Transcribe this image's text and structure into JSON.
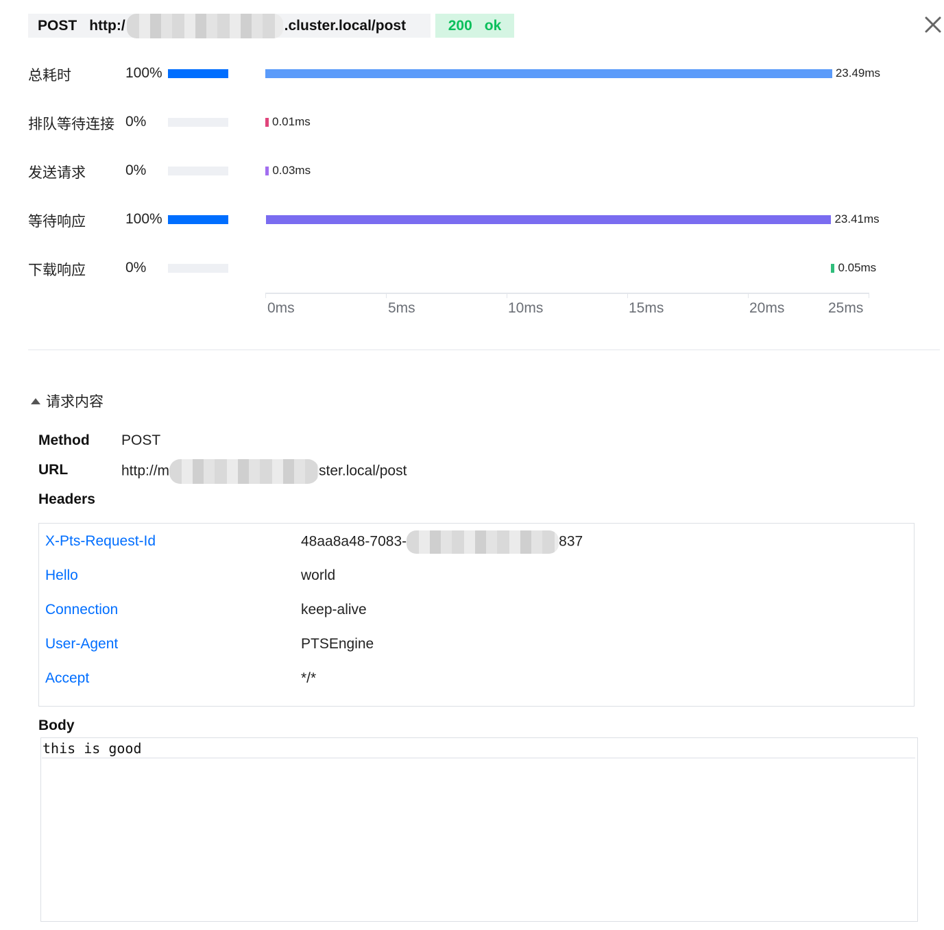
{
  "request": {
    "method": "POST",
    "url_prefix": "http:/",
    "url_suffix": ".cluster.local/post",
    "status_code": "200",
    "status_text": "ok"
  },
  "timings": [
    {
      "label": "总耗时",
      "percent": "100%",
      "share": 1.0,
      "start_ms": 0,
      "duration_ms": 23.49,
      "value_label": "23.49ms",
      "color": "#5b9bfa"
    },
    {
      "label": "排队等待连接",
      "percent": "0%",
      "share": 0.0,
      "start_ms": 0,
      "duration_ms": 0.01,
      "value_label": "0.01ms",
      "color": "#e0457b"
    },
    {
      "label": "发送请求",
      "percent": "0%",
      "share": 0.0,
      "start_ms": 0.01,
      "duration_ms": 0.03,
      "value_label": "0.03ms",
      "color": "#a26ef0"
    },
    {
      "label": "等待响应",
      "percent": "100%",
      "share": 1.0,
      "start_ms": 0.04,
      "duration_ms": 23.41,
      "value_label": "23.41ms",
      "color": "#7a6cf0"
    },
    {
      "label": "下载响应",
      "percent": "0%",
      "share": 0.0,
      "start_ms": 23.45,
      "duration_ms": 0.05,
      "value_label": "0.05ms",
      "color": "#2fbd7b"
    }
  ],
  "axis": {
    "ticks": [
      "0ms",
      "5ms",
      "10ms",
      "15ms",
      "20ms",
      "25ms"
    ],
    "max_ms": 25
  },
  "section": {
    "title": "请求内容",
    "method_key": "Method",
    "method_value": "POST",
    "url_key": "URL",
    "url_prefix": "http://m",
    "url_suffix": "ster.local/post",
    "headers_key": "Headers",
    "headers": [
      {
        "name": "X-Pts-Request-Id",
        "value_prefix": "48aa8a48-7083-",
        "value_suffix": "837"
      },
      {
        "name": "Hello",
        "value_prefix": "world",
        "value_suffix": ""
      },
      {
        "name": "Connection",
        "value_prefix": "keep-alive",
        "value_suffix": ""
      },
      {
        "name": "User-Agent",
        "value_prefix": "PTSEngine",
        "value_suffix": ""
      },
      {
        "name": "Accept",
        "value_prefix": "*/*",
        "value_suffix": ""
      }
    ],
    "body_key": "Body",
    "body_text": "this is good"
  }
}
